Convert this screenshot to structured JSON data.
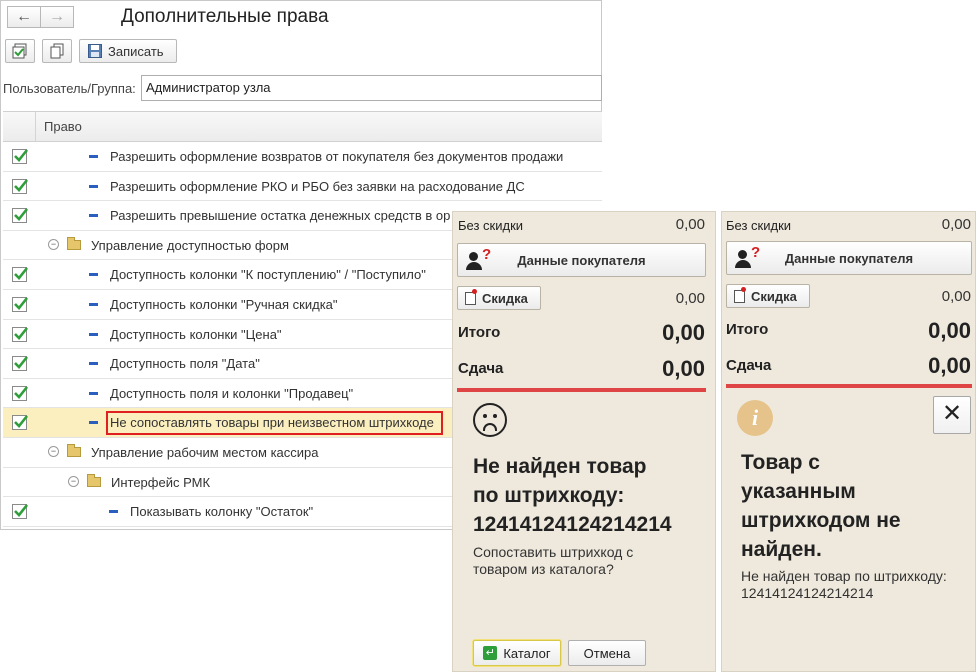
{
  "window": {
    "title": "Дополнительные права",
    "nav_back": "←",
    "nav_forward": "→"
  },
  "toolbar": {
    "save_label": "Записать"
  },
  "user_group": {
    "label": "Пользователь/Группа:",
    "value": "Администратор узла"
  },
  "grid": {
    "header": "Право",
    "rows": [
      {
        "checked": true,
        "type": "item",
        "level": 1,
        "label": "Разрешить оформление возвратов от покупателя без документов продажи"
      },
      {
        "checked": true,
        "type": "item",
        "level": 1,
        "label": "Разрешить оформление РКО и РБО без заявки на расходование ДС"
      },
      {
        "checked": true,
        "type": "item",
        "level": 1,
        "label": "Разрешить превышение остатка денежных средств в ор"
      },
      {
        "checked": false,
        "type": "group",
        "level": 0,
        "label": "Управление доступностью форм"
      },
      {
        "checked": true,
        "type": "item",
        "level": 1,
        "label": "Доступность колонки \"К поступлению\" / \"Поступило\""
      },
      {
        "checked": true,
        "type": "item",
        "level": 1,
        "label": "Доступность колонки \"Ручная скидка\""
      },
      {
        "checked": true,
        "type": "item",
        "level": 1,
        "label": "Доступность колонки \"Цена\""
      },
      {
        "checked": true,
        "type": "item",
        "level": 1,
        "label": "Доступность поля \"Дата\""
      },
      {
        "checked": true,
        "type": "item",
        "level": 1,
        "label": "Доступность поля и колонки \"Продавец\""
      },
      {
        "checked": true,
        "type": "item",
        "level": 1,
        "label": "Не сопоставлять товары при неизвестном штрихкоде",
        "selected": true
      },
      {
        "checked": false,
        "type": "group",
        "level": 0,
        "label": "Управление рабочим местом кассира"
      },
      {
        "checked": false,
        "type": "group",
        "level": 1,
        "label": "Интерфейс РМК"
      },
      {
        "checked": true,
        "type": "item",
        "level": 2,
        "label": "Показывать колонку \"Остаток\""
      }
    ]
  },
  "pos_left": {
    "no_discount_label": "Без скидки",
    "no_discount_value": "0,00",
    "customer_button": "Данные покупателя",
    "discount_button": "Скидка",
    "discount_value": "0,00",
    "total_label": "Итого",
    "total_value": "0,00",
    "change_label": "Сдача",
    "change_value": "0,00",
    "message_title": "Не найден товар по штрихкоду: 12414124124214214",
    "message_title_lines": [
      "Не найден товар",
      "по штрихкоду:",
      "12414124124214214"
    ],
    "message_sub_lines": [
      "Сопоставить штрихкод с",
      "товаром из каталога?"
    ],
    "catalog_button": "Каталог",
    "cancel_button": "Отмена"
  },
  "pos_right": {
    "no_discount_label": "Без скидки",
    "no_discount_value": "0,00",
    "customer_button": "Данные покупателя",
    "discount_button": "Скидка",
    "discount_value": "0,00",
    "total_label": "Итого",
    "total_value": "0,00",
    "change_label": "Сдача",
    "change_value": "0,00",
    "message_title_lines": [
      "Товар с",
      "указанным",
      "штрихкодом не",
      "найден."
    ],
    "message_sub_lines": [
      "Не найден товар по штрихкоду:",
      "12414124124214214"
    ],
    "close_label": "✕"
  },
  "colors": {
    "accent_red": "#e04545",
    "selected_row": "#fbefbf",
    "highlight_border": "#e02020",
    "pos_bg": "#efe9dd",
    "check_green": "#2e9e3a"
  }
}
